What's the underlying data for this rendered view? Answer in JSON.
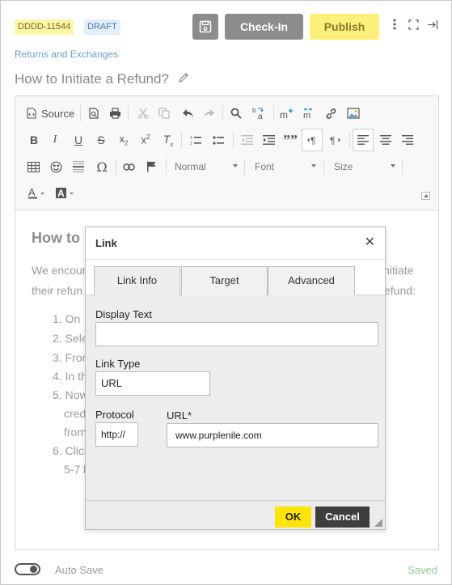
{
  "header": {
    "doc_id": "DDDD-11544",
    "status": "DRAFT",
    "checkin_label": "Check-In",
    "publish_label": "Publish",
    "breadcrumb": "Returns and Exchanges",
    "title": "How to Initiate a Refund?"
  },
  "toolbar": {
    "source_label": "Source",
    "format_value": "Normal",
    "font_value": "Font",
    "size_value": "Size"
  },
  "content": {
    "heading": "How to",
    "para_line1_left": "We encour",
    "para_line1_right": "initiate",
    "para_line2_left": "their refun",
    "para_line2_right": "efund:",
    "list": [
      {
        "num": "1.",
        "text": "On"
      },
      {
        "num": "2.",
        "text": "Sele"
      },
      {
        "num": "3.",
        "text": "Fron"
      },
      {
        "num": "4.",
        "text": "In th"
      },
      {
        "num": "5.",
        "text": "Now"
      },
      {
        "num": "",
        "text": "cred"
      },
      {
        "num": "",
        "text": "from"
      },
      {
        "num": "6.",
        "text": "Click"
      },
      {
        "num": "",
        "text": "5-7 l"
      }
    ]
  },
  "dialog": {
    "title": "Link",
    "tabs": [
      "Link Info",
      "Target",
      "Advanced"
    ],
    "display_text_label": "Display Text",
    "display_text_value": "",
    "link_type_label": "Link Type",
    "link_type_value": "URL",
    "protocol_label": "Protocol",
    "protocol_value": "http://",
    "url_label": "URL*",
    "url_value": "www.purplenile.com",
    "ok_label": "OK",
    "cancel_label": "Cancel"
  },
  "footer": {
    "autosave_label": "Auto Save",
    "saved_label": "Saved"
  },
  "colors": {
    "publish_bg": "#fdf07a",
    "ok_bg": "#ffe40a",
    "cancel_bg": "#3e3e3e",
    "saved_text": "#8fcb9a",
    "breadcrumb_text": "#6d9ec8"
  }
}
